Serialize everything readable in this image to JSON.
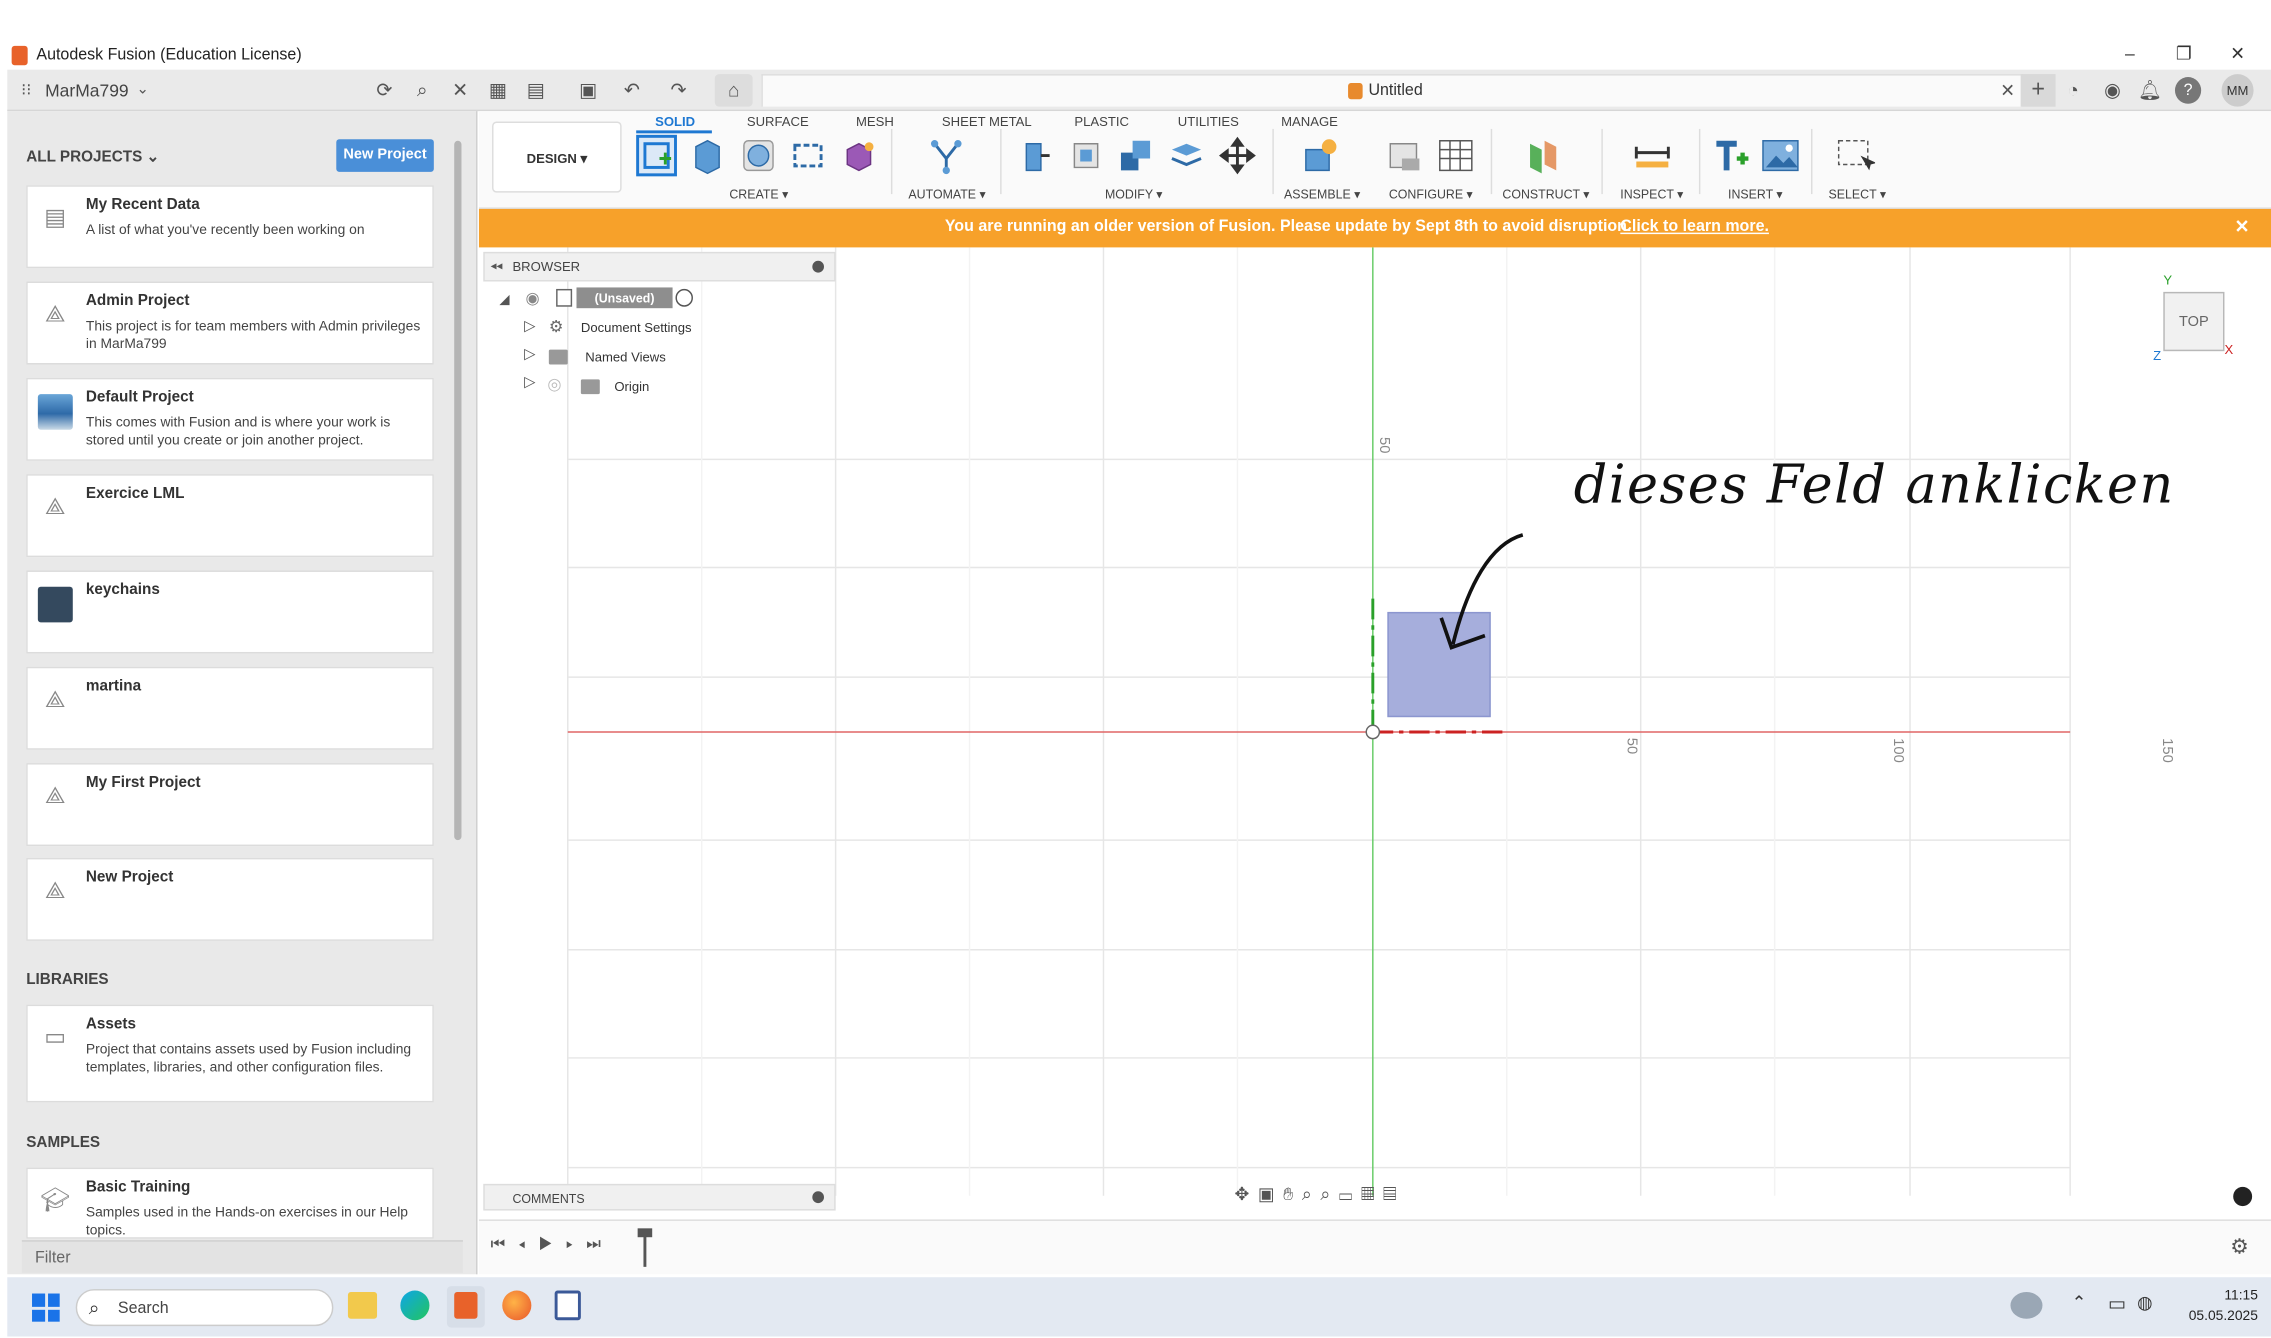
{
  "window": {
    "title": "Autodesk Fusion (Education License)",
    "controls": [
      "–",
      "❐",
      "✕"
    ]
  },
  "app_header": {
    "user": "MarMa799",
    "document_tab": "Untitled",
    "avatar_initials": "MM"
  },
  "data_panel": {
    "projects_heading": "ALL PROJECTS",
    "new_project_label": "New Project",
    "projects": [
      {
        "name": "My Recent Data",
        "description": "A list of what you've recently been working on",
        "icon": "document-icon"
      },
      {
        "name": "Admin Project",
        "description": "This project is for team members with Admin privileges in MarMa799",
        "icon": "project-icon"
      },
      {
        "name": "Default Project",
        "description": "This comes with Fusion and is where your work is stored until you create or join another project.",
        "icon": "landscape-thumbnail"
      },
      {
        "name": "Exercice LML",
        "description": "",
        "icon": "project-icon"
      },
      {
        "name": "keychains",
        "description": "",
        "icon": "thumbnail"
      },
      {
        "name": "martina",
        "description": "",
        "icon": "project-icon"
      },
      {
        "name": "My First Project",
        "description": "",
        "icon": "project-icon"
      },
      {
        "name": "New Project",
        "description": "",
        "icon": "project-icon"
      }
    ],
    "libraries_heading": "LIBRARIES",
    "libraries": [
      {
        "name": "Assets",
        "description": "Project that contains assets used by Fusion including templates, libraries, and other configuration files.",
        "icon": "archive-icon"
      }
    ],
    "samples_heading": "SAMPLES",
    "samples": [
      {
        "name": "Basic Training",
        "description": "Samples used in the Hands-on exercises in our Help topics.",
        "icon": "graduation-cap-icon"
      }
    ],
    "filter_placeholder": "Filter"
  },
  "toolbar": {
    "workspace": "DESIGN ▾",
    "tabs": [
      "SOLID",
      "SURFACE",
      "MESH",
      "SHEET METAL",
      "PLASTIC",
      "UTILITIES",
      "MANAGE"
    ],
    "active_tab": "SOLID",
    "groups": [
      "CREATE ▾",
      "AUTOMATE ▾",
      "MODIFY ▾",
      "ASSEMBLE ▾",
      "CONFIGURE ▾",
      "CONSTRUCT ▾",
      "INSPECT ▾",
      "INSERT ▾",
      "SELECT ▾"
    ],
    "accent": "#1e78d2"
  },
  "banner": {
    "text": "You are running an older version of Fusion. Please update by Sept 8th to avoid disruption.",
    "link": "Click to learn more.",
    "close": "✕",
    "color": "#f7a12a"
  },
  "browser": {
    "title": "BROWSER",
    "root": "(Unsaved)",
    "items": [
      "Document Settings",
      "Named Views",
      "Origin"
    ]
  },
  "comments_label": "COMMENTS",
  "viewcube": {
    "face": "TOP",
    "x": "X",
    "y": "Y",
    "z": "Z"
  },
  "grid_labels": {
    "y50": "50",
    "x50": "50",
    "x100": "100",
    "x150": "150"
  },
  "annotation": "dieses Feld anklicken",
  "taskbar": {
    "search_placeholder": "Search",
    "time": "11:15",
    "date": "05.05.2025"
  }
}
